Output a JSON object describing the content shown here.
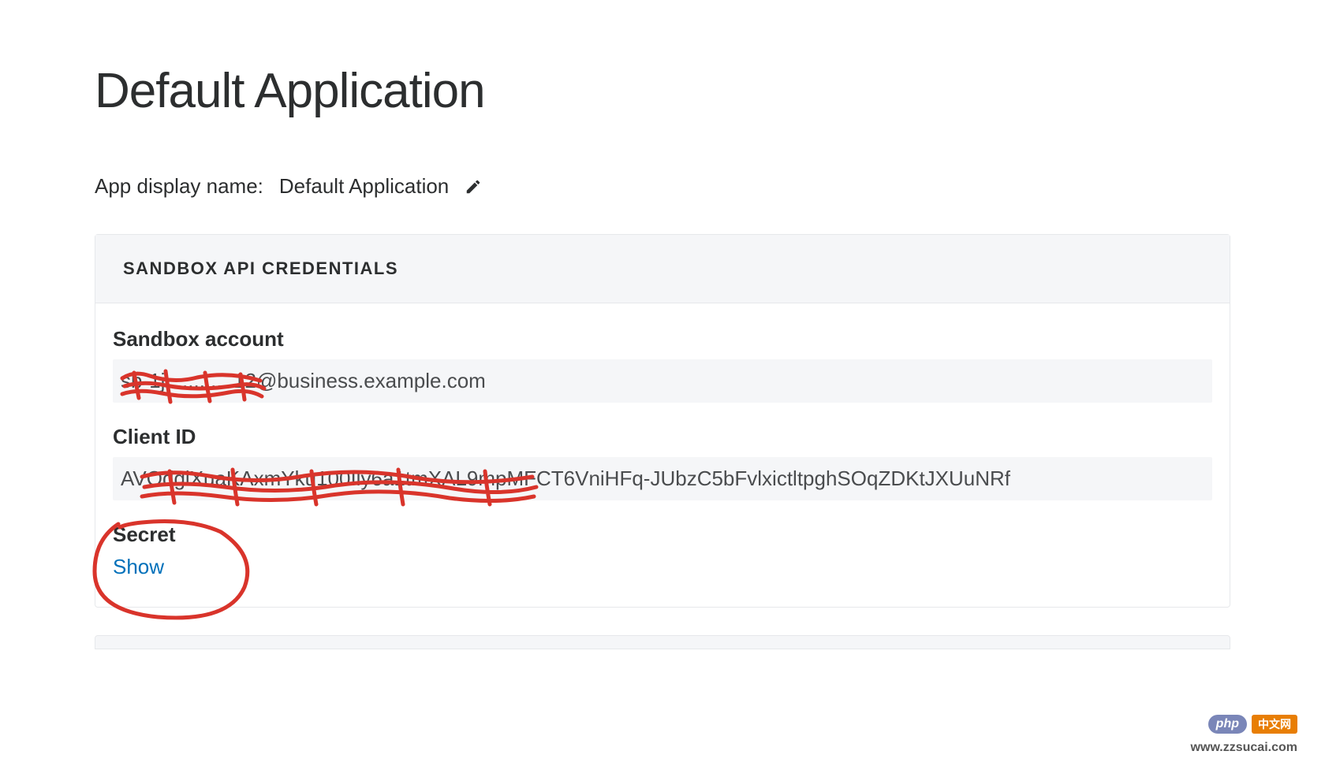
{
  "page_title": "Default Application",
  "display_name": {
    "label": "App display name:",
    "value": "Default Application"
  },
  "credentials_card": {
    "header": "SANDBOX API CREDENTIALS",
    "sandbox_account": {
      "label": "Sandbox account",
      "value": "sb-1j............12@business.example.com"
    },
    "client_id": {
      "label": "Client ID",
      "value": "AVOdglXuaKAxmYku100Ily6a1tmXAL9mpMFCT6VniHFq-JUbzC5bFvlxictltpghSOqZDKtJXUuNRf"
    },
    "secret": {
      "label": "Secret",
      "show_link": "Show"
    }
  },
  "watermarks": {
    "php_badge": "php",
    "php_text": "中文网",
    "zz": "www.zzsucai.com"
  },
  "annotation_color": "#d9342b"
}
